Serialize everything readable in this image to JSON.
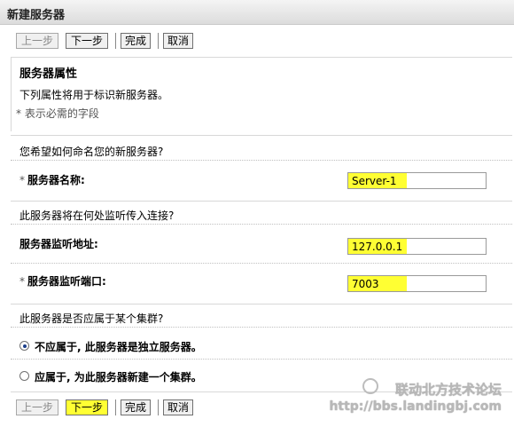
{
  "window": {
    "title": "新建服务器"
  },
  "toolbar": {
    "prev_label": "上一步",
    "next_label": "下一步",
    "finish_label": "完成",
    "cancel_label": "取消"
  },
  "section": {
    "title": "服务器属性",
    "description": "下列属性将用于标识新服务器。",
    "required_note": "* 表示必需的字段"
  },
  "name_group": {
    "question": "您希望如何命名您的新服务器?",
    "required_mark": "*",
    "label": "服务器名称:",
    "value": "Server-1"
  },
  "listen_group": {
    "question": "此服务器将在何处监听传入连接?",
    "address_label": "服务器监听地址:",
    "address_value": "127.0.0.1",
    "port_required_mark": "*",
    "port_label": "服务器监听端口:",
    "port_value": "7003"
  },
  "cluster_group": {
    "question": "此服务器是否应属于某个集群?",
    "options": [
      {
        "label": "不应属于, 此服务器是独立服务器。",
        "checked": true
      },
      {
        "label": "应属于, 为此服务器新建一个集群。",
        "checked": false
      }
    ]
  },
  "watermark": {
    "line1": "联动北方技术论坛",
    "line2": "http://bbs.landingbj.com"
  },
  "colors": {
    "highlight": "#ffff33"
  }
}
